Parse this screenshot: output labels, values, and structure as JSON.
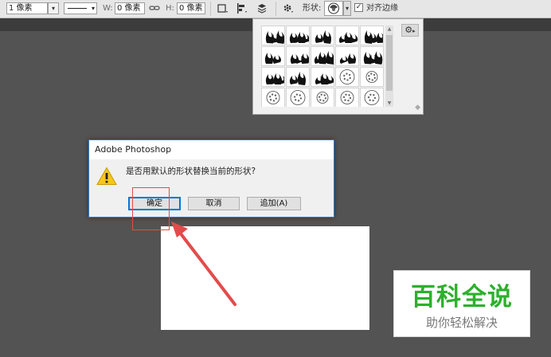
{
  "options_bar": {
    "stroke_width": "1 像素",
    "width_label": "W:",
    "width_value": "0 像素",
    "height_label": "H:",
    "height_value": "0 像素",
    "shape_label": "形状:",
    "align_edges_label": "对齐边缘",
    "align_edges_checked": true
  },
  "dialog": {
    "title": "Adobe Photoshop",
    "message": "是否用默认的形状替换当前的形状?",
    "buttons": {
      "ok": "确定",
      "cancel": "取消",
      "append": "追加(A)"
    }
  },
  "watermark": {
    "title": "百科全说",
    "subtitle": "助你轻松解决"
  },
  "shape_picker": {
    "shapes": [
      "flames-1",
      "flames-2",
      "flames-3",
      "flames-4",
      "flames-5",
      "flames-6",
      "flames-7",
      "flames-8",
      "flames-9",
      "flames-10",
      "flames-11",
      "flames-12",
      "flames-13",
      "ornament-1",
      "ornament-2",
      "ornament-3",
      "ornament-4",
      "ornament-5",
      "ornament-6",
      "ornament-7"
    ]
  },
  "colors": {
    "workspace": "#535353",
    "dialog_accent": "#0078d7",
    "annotation_red": "#e34b4b",
    "watermark_green": "#2db02d"
  }
}
